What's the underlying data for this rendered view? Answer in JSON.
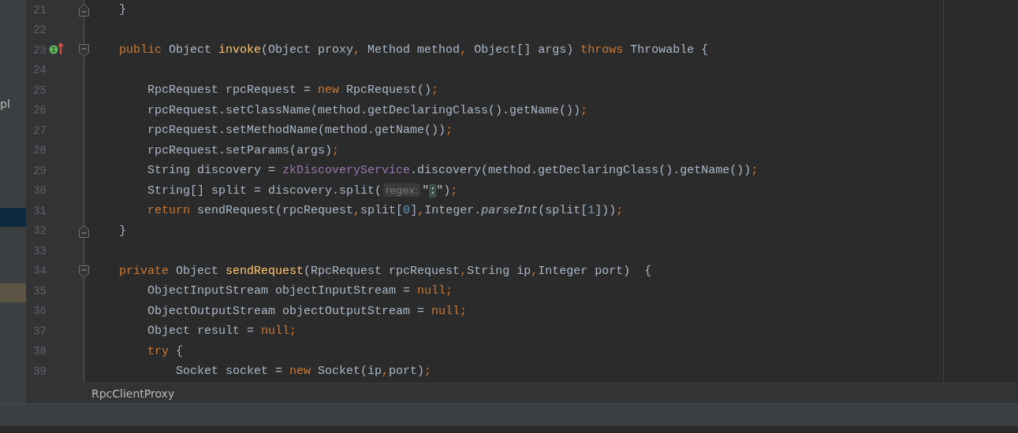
{
  "project_panel": {
    "rows": [
      {
        "label": "pl",
        "selected": false,
        "highlighted": false
      },
      {
        "selected": false,
        "highlighted": false
      },
      {
        "selected": false,
        "highlighted": false
      },
      {
        "selected": false,
        "highlighted": false
      },
      {
        "selected": false,
        "highlighted": false
      },
      {
        "selected": false,
        "highlighted": false
      },
      {
        "selected": true,
        "highlighted": false
      },
      {
        "selected": false,
        "highlighted": false
      },
      {
        "selected": false,
        "highlighted": false
      },
      {
        "selected": false,
        "highlighted": false
      },
      {
        "selected": false,
        "highlighted": true
      }
    ]
  },
  "editor": {
    "lines": [
      {
        "number": "21",
        "fold_close": true,
        "tokens": [
          {
            "kind": "plain",
            "text": "    }"
          }
        ]
      },
      {
        "number": "22"
      },
      {
        "number": "23",
        "fold_open": true,
        "gutter_icon": true,
        "tokens": [
          {
            "kind": "keyword",
            "text": "    public"
          },
          {
            "kind": "plain",
            "text": " Object "
          },
          {
            "kind": "declaration",
            "text": "invoke"
          },
          {
            "kind": "plain",
            "text": "(Object proxy"
          },
          {
            "kind": "keyword",
            "text": ","
          },
          {
            "kind": "plain",
            "text": " Method method"
          },
          {
            "kind": "keyword",
            "text": ","
          },
          {
            "kind": "plain",
            "text": " Object[] args) "
          },
          {
            "kind": "keyword",
            "text": "throws"
          },
          {
            "kind": "plain",
            "text": " Throwable {"
          }
        ]
      },
      {
        "number": "24"
      },
      {
        "number": "25",
        "tokens": [
          {
            "kind": "plain",
            "text": "        RpcRequest rpcRequest = "
          },
          {
            "kind": "keyword",
            "text": "new"
          },
          {
            "kind": "plain",
            "text": " RpcRequest()"
          },
          {
            "kind": "keyword",
            "text": ";"
          }
        ]
      },
      {
        "number": "26",
        "tokens": [
          {
            "kind": "plain",
            "text": "        rpcRequest.setClassName(method.getDeclaringClass().getName())"
          },
          {
            "kind": "keyword",
            "text": ";"
          }
        ]
      },
      {
        "number": "27",
        "tokens": [
          {
            "kind": "plain",
            "text": "        rpcRequest.setMethodName(method.getName())"
          },
          {
            "kind": "keyword",
            "text": ";"
          }
        ]
      },
      {
        "number": "28",
        "tokens": [
          {
            "kind": "plain",
            "text": "        rpcRequest.setParams(args)"
          },
          {
            "kind": "keyword",
            "text": ";"
          }
        ]
      },
      {
        "number": "29",
        "tokens": [
          {
            "kind": "plain",
            "text": "        String discovery = "
          },
          {
            "kind": "field",
            "text": "zkDiscoveryService"
          },
          {
            "kind": "plain",
            "text": ".discovery(method.getDeclaringClass().getName())"
          },
          {
            "kind": "keyword",
            "text": ";"
          }
        ]
      },
      {
        "number": "30",
        "tokens": [
          {
            "kind": "plain",
            "text": "        String[] split = discovery.split("
          },
          {
            "kind": "hint",
            "text": "regex:"
          },
          {
            "kind": "string",
            "text": "\""
          },
          {
            "kind": "match",
            "text": ":"
          },
          {
            "kind": "string",
            "text": "\""
          },
          {
            "kind": "plain",
            "text": ")"
          },
          {
            "kind": "keyword",
            "text": ";"
          }
        ]
      },
      {
        "number": "31",
        "tokens": [
          {
            "kind": "keyword",
            "text": "        return"
          },
          {
            "kind": "plain",
            "text": " sendRequest(rpcRequest"
          },
          {
            "kind": "keyword",
            "text": ","
          },
          {
            "kind": "plain",
            "text": "split["
          },
          {
            "kind": "number",
            "text": "0"
          },
          {
            "kind": "plain",
            "text": "]"
          },
          {
            "kind": "keyword",
            "text": ","
          },
          {
            "kind": "plain",
            "text": "Integer."
          },
          {
            "kind": "static",
            "text": "parseInt"
          },
          {
            "kind": "plain",
            "text": "(split["
          },
          {
            "kind": "number",
            "text": "1"
          },
          {
            "kind": "plain",
            "text": "]))"
          },
          {
            "kind": "keyword",
            "text": ";"
          }
        ]
      },
      {
        "number": "32",
        "fold_close": true,
        "tokens": [
          {
            "kind": "plain",
            "text": "    }"
          }
        ]
      },
      {
        "number": "33"
      },
      {
        "number": "34",
        "fold_open": true,
        "tokens": [
          {
            "kind": "keyword",
            "text": "    private"
          },
          {
            "kind": "plain",
            "text": " Object "
          },
          {
            "kind": "declaration",
            "text": "sendRequest"
          },
          {
            "kind": "plain",
            "text": "(RpcRequest rpcRequest"
          },
          {
            "kind": "keyword",
            "text": ","
          },
          {
            "kind": "plain",
            "text": "String ip"
          },
          {
            "kind": "keyword",
            "text": ","
          },
          {
            "kind": "plain",
            "text": "Integer port)  {"
          }
        ]
      },
      {
        "number": "35",
        "tokens": [
          {
            "kind": "plain",
            "text": "        ObjectInputStream objectInputStream = "
          },
          {
            "kind": "keyword",
            "text": "null;"
          }
        ]
      },
      {
        "number": "36",
        "tokens": [
          {
            "kind": "plain",
            "text": "        ObjectOutputStream objectOutputStream = "
          },
          {
            "kind": "keyword",
            "text": "null;"
          }
        ]
      },
      {
        "number": "37",
        "tokens": [
          {
            "kind": "plain",
            "text": "        Object result = "
          },
          {
            "kind": "keyword",
            "text": "null;"
          }
        ]
      },
      {
        "number": "38",
        "tokens": [
          {
            "kind": "keyword",
            "text": "        try"
          },
          {
            "kind": "plain",
            "text": " {"
          }
        ]
      },
      {
        "number": "39",
        "tokens": [
          {
            "kind": "plain",
            "text": "            Socket socket = "
          },
          {
            "kind": "keyword",
            "text": "new"
          },
          {
            "kind": "plain",
            "text": " Socket(ip"
          },
          {
            "kind": "keyword",
            "text": ","
          },
          {
            "kind": "plain",
            "text": "port)"
          },
          {
            "kind": "keyword",
            "text": ";"
          }
        ]
      }
    ]
  },
  "breadcrumb": "RpcClientProxy"
}
